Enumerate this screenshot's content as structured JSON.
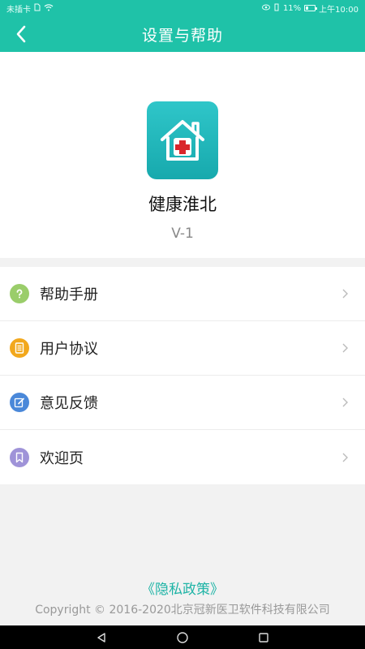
{
  "status_bar": {
    "carrier": "未插卡",
    "battery": "11%",
    "time": "上午10:00"
  },
  "app_bar": {
    "title": "设置与帮助"
  },
  "app_info": {
    "name": "健康淮北",
    "version": "V-1"
  },
  "menu": {
    "items": [
      {
        "label": "帮助手册",
        "icon": "help-icon",
        "color": "#9acd6a"
      },
      {
        "label": "用户协议",
        "icon": "document-icon",
        "color": "#f2a81d"
      },
      {
        "label": "意见反馈",
        "icon": "edit-icon",
        "color": "#4a88d9"
      },
      {
        "label": "欢迎页",
        "icon": "bookmark-icon",
        "color": "#9f93d8"
      }
    ]
  },
  "footer": {
    "privacy": "《隐私政策》",
    "copyright": "Copyright © 2016-2020北京冠新医卫软件科技有限公司"
  },
  "colors": {
    "primary": "#1fc2a8",
    "link": "#1fb4a6"
  }
}
